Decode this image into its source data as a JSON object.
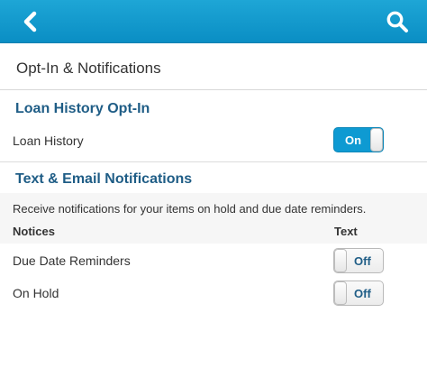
{
  "header": {
    "back_icon": "chevron-left-icon",
    "search_icon": "search-icon",
    "accent": "#0e9ad2"
  },
  "page": {
    "title": "Opt-In & Notifications"
  },
  "loan_history": {
    "heading": "Loan History Opt-In",
    "row_label": "Loan History",
    "toggle": {
      "state": true,
      "label": "On"
    }
  },
  "notifications": {
    "heading": "Text & Email Notifications",
    "description": "Receive notifications for your items on hold and due date reminders.",
    "columns": {
      "notices": "Notices",
      "text": "Text"
    },
    "rows": [
      {
        "label": "Due Date Reminders",
        "toggle": {
          "state": false,
          "label": "Off"
        }
      },
      {
        "label": "On Hold",
        "toggle": {
          "state": false,
          "label": "Off"
        }
      }
    ]
  }
}
